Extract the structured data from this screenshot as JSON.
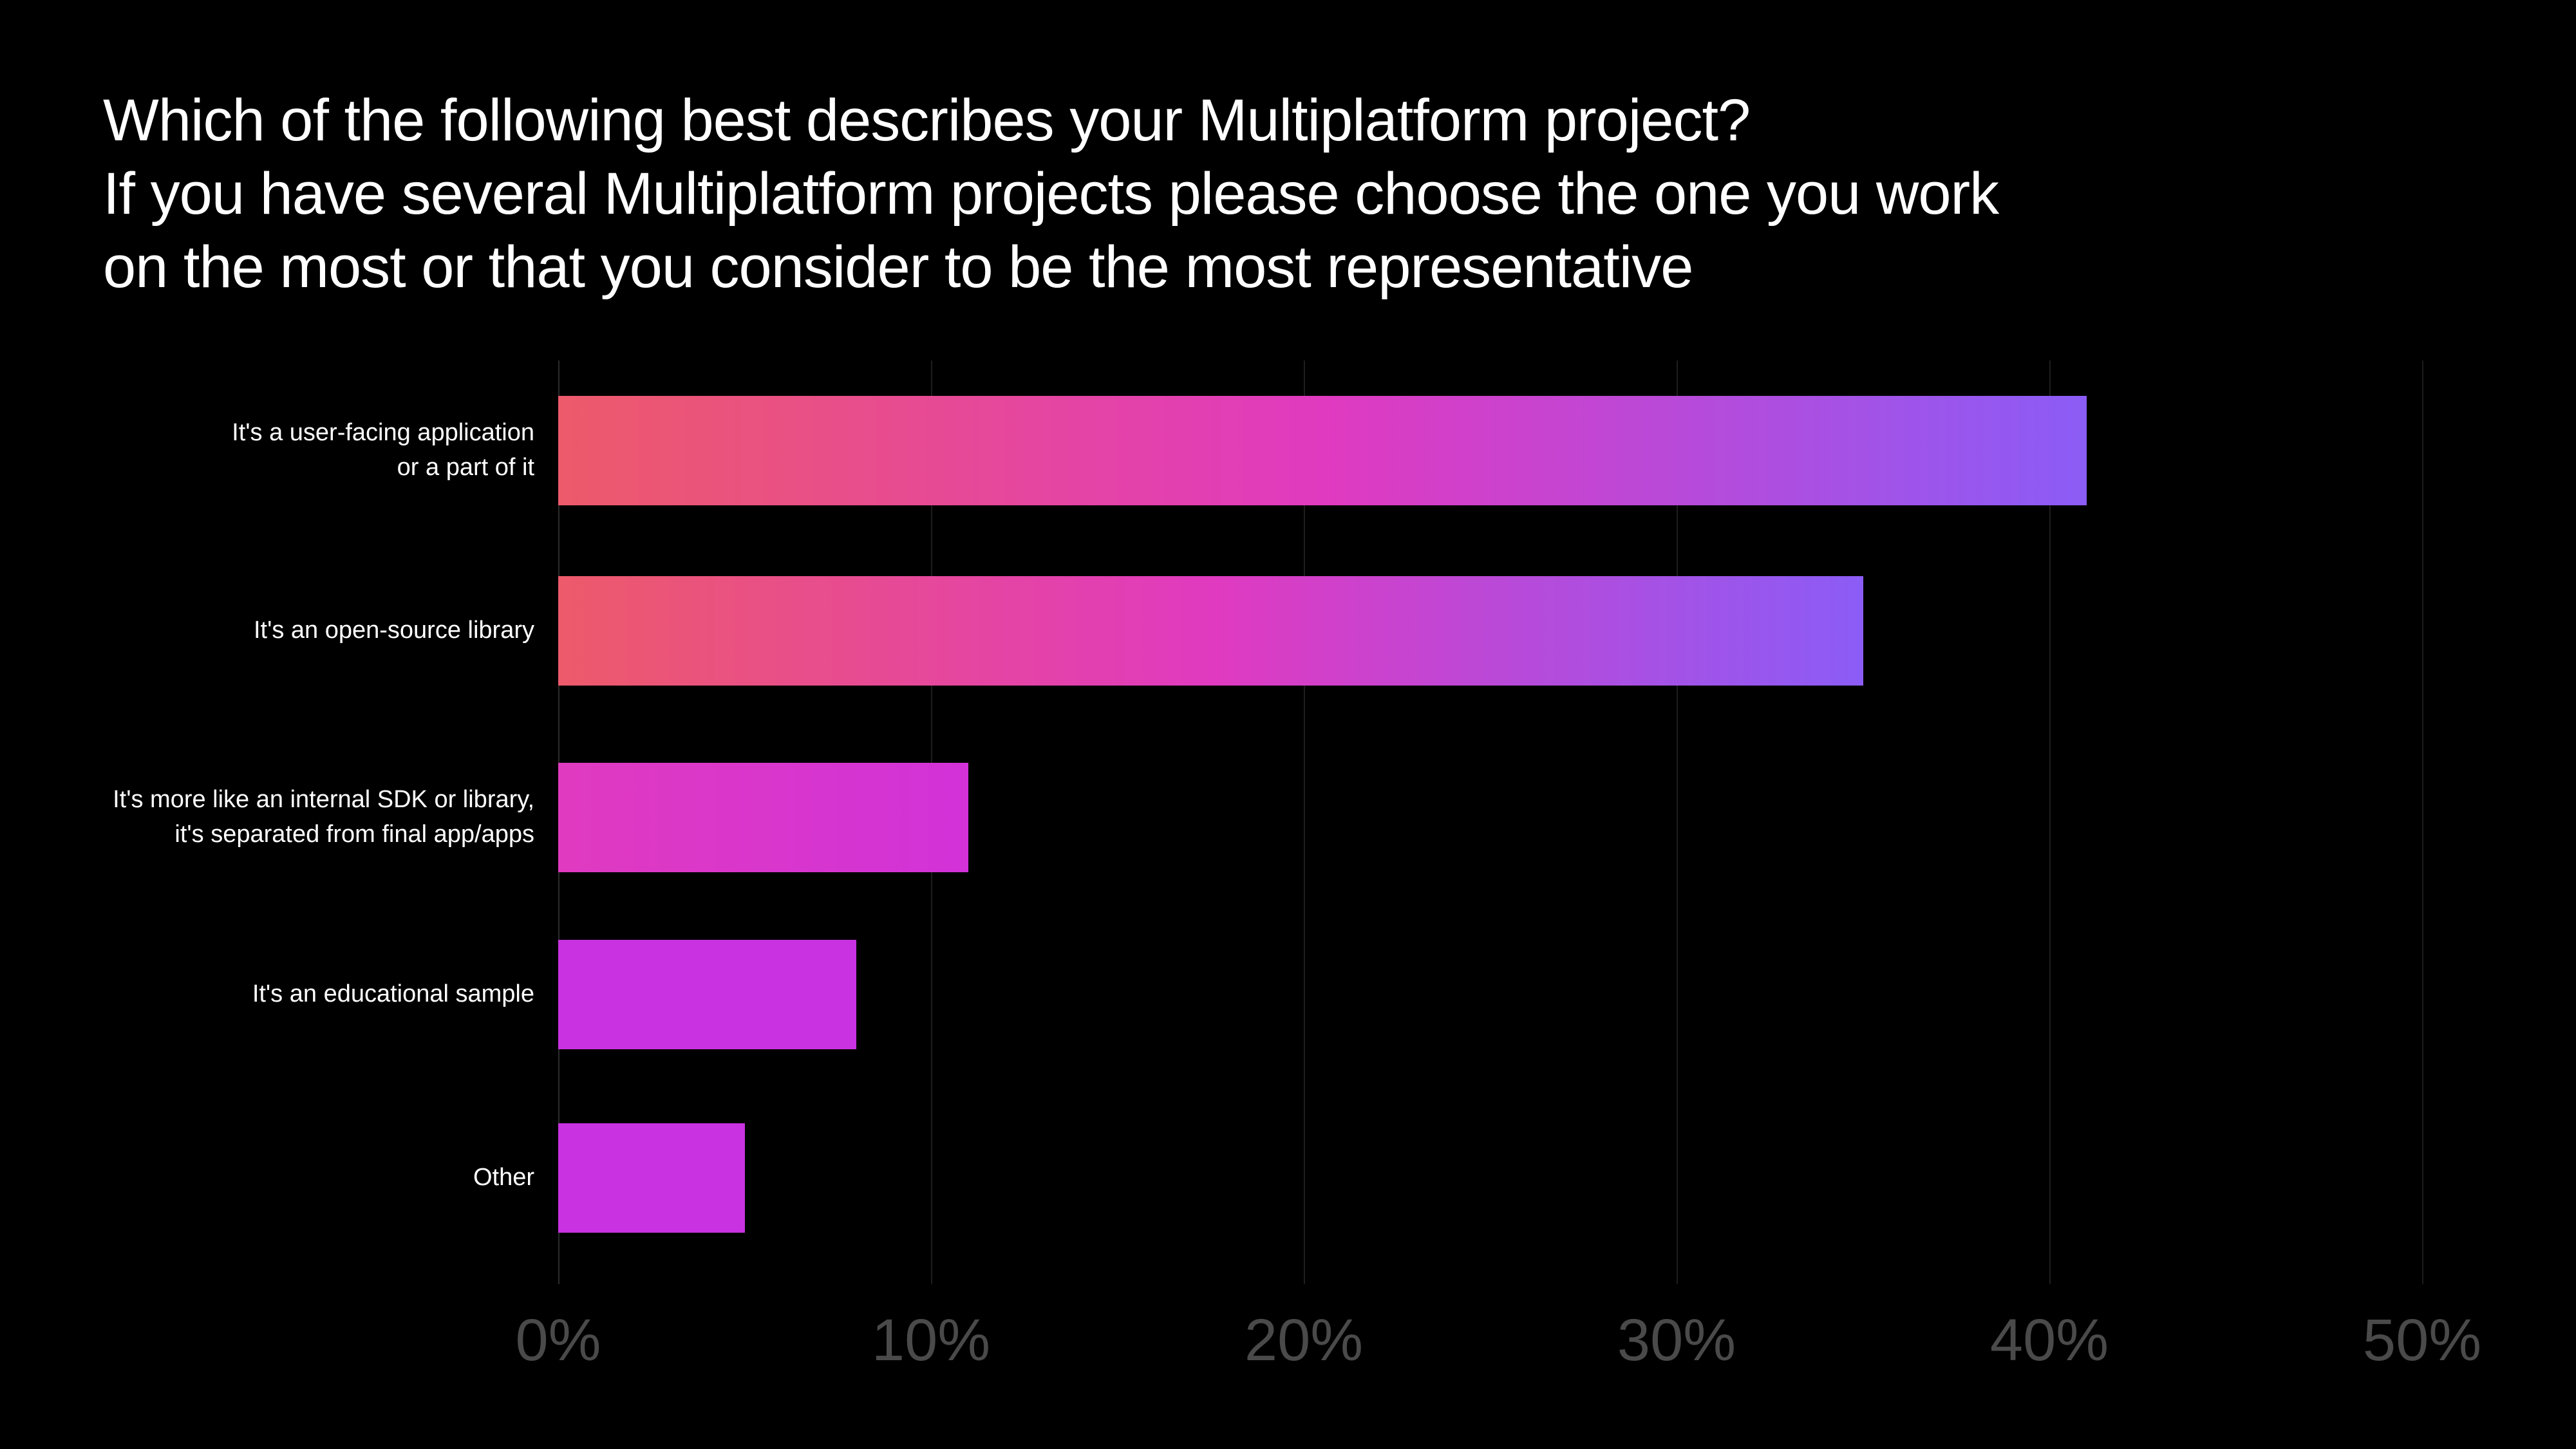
{
  "title_line1": "Which of the following best describes your Multiplatform project?",
  "title_line2": "If you have several Multiplatform projects please choose the one you work",
  "title_line3": "on the most or that you consider to be the most representative",
  "chart_data": {
    "type": "bar",
    "orientation": "horizontal",
    "title": "Which of the following best describes your Multiplatform project? If you have several Multiplatform projects please choose the one you work on the most or that you consider to be the most representative",
    "categories": [
      "It's a user-facing application or a part of it",
      "It's an open-source library",
      "It's more like an internal SDK or library, it's separated from final app/apps",
      "It's an educational sample",
      "Other"
    ],
    "values": [
      41,
      35,
      11,
      8,
      5
    ],
    "xlabel": "",
    "ylabel": "",
    "xlim": [
      0,
      50
    ],
    "ticks": [
      0,
      10,
      20,
      30,
      40,
      50
    ],
    "tick_labels": [
      "0%",
      "10%",
      "20%",
      "30%",
      "40%",
      "50%"
    ],
    "grid": true
  },
  "bars": [
    {
      "label_lines": [
        "It's a user-facing application",
        "or a part of it"
      ],
      "value": 41
    },
    {
      "label_lines": [
        "It's an open-source library"
      ],
      "value": 35
    },
    {
      "label_lines": [
        "It's more like an internal SDK or library,",
        "it's separated from final app/apps"
      ],
      "value": 11
    },
    {
      "label_lines": [
        "It's an educational sample"
      ],
      "value": 8
    },
    {
      "label_lines": [
        "Other"
      ],
      "value": 5
    }
  ],
  "colors": {
    "grad_start": "#ED5A6A",
    "grad_mid": "#E03AC0",
    "grad_end": "#8B5CF6",
    "small_bar": "#C832E0"
  }
}
